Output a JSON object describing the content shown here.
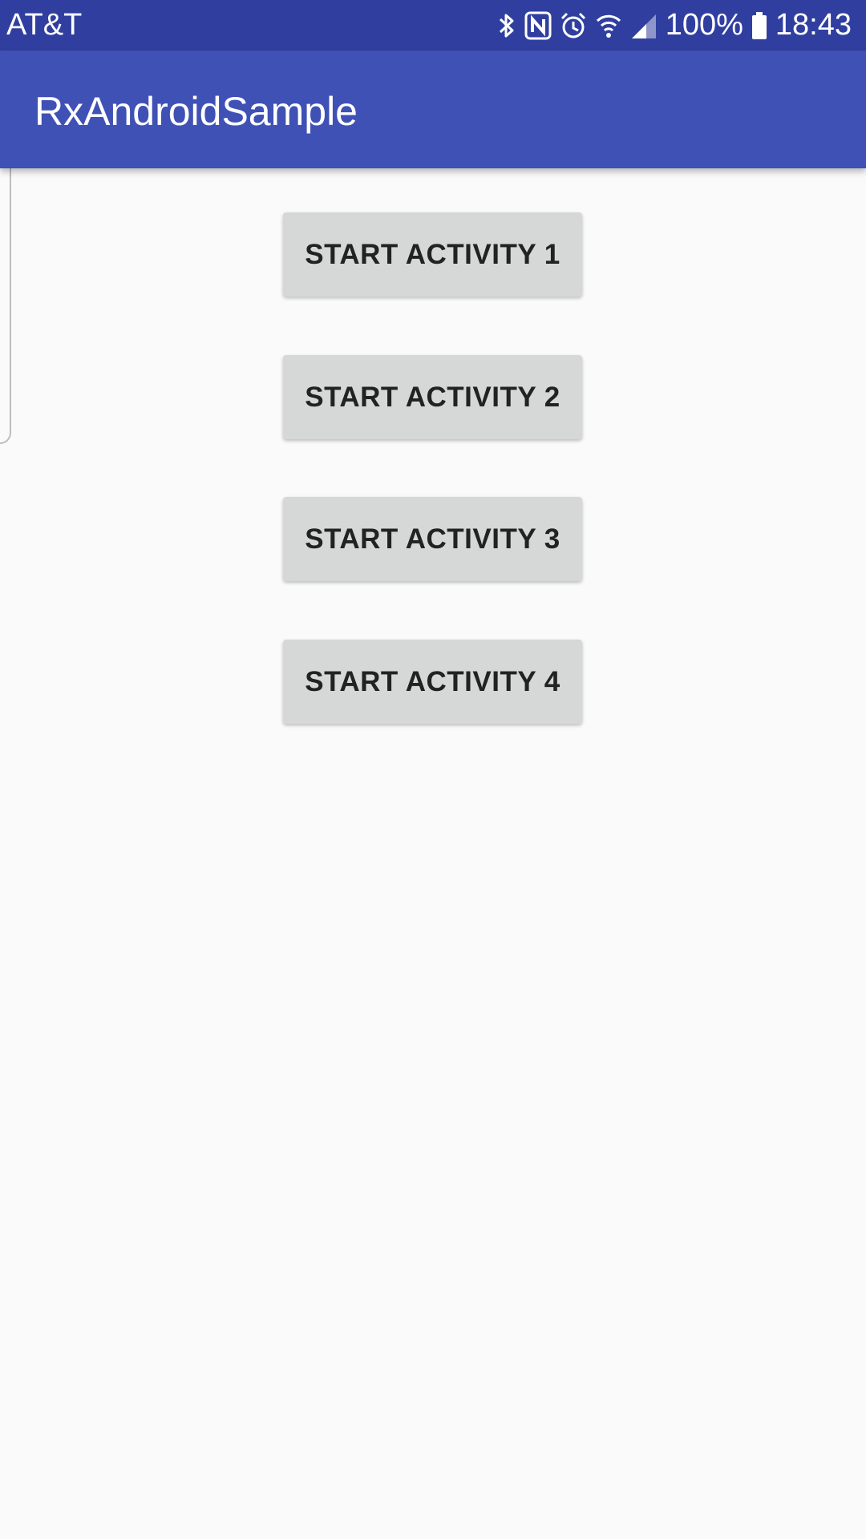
{
  "status_bar": {
    "carrier": "AT&T",
    "battery_percent": "100%",
    "time": "18:43",
    "icons": [
      "bluetooth-icon",
      "nfc-icon",
      "alarm-icon",
      "wifi-icon",
      "signal-icon",
      "battery-icon"
    ]
  },
  "app_bar": {
    "title": "RxAndroidSample"
  },
  "main": {
    "buttons": [
      {
        "label": "START ACTIVITY 1"
      },
      {
        "label": "START ACTIVITY 2"
      },
      {
        "label": "START ACTIVITY 3"
      },
      {
        "label": "START ACTIVITY 4"
      }
    ]
  },
  "colors": {
    "status_bar": "#303f9f",
    "primary": "#3f51b5",
    "background": "#fafafa",
    "button": "#d6d7d7",
    "button_text": "#222222"
  }
}
